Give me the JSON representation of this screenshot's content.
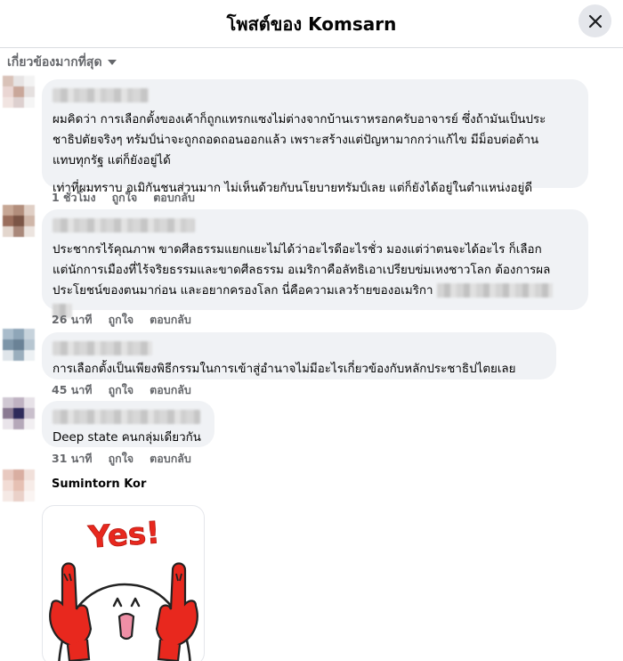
{
  "header": {
    "title": "โพสต์ของ Komsarn"
  },
  "sort": {
    "label": "เกี่ยวข้องมากที่สุด"
  },
  "comments": [
    {
      "paragraphs": [
        "ผมคิดว่า การเลือกตั้งของเค้าก็ถูกแทรกแซงไม่ต่างจากบ้านเราหรอกครับอาจารย์ ซึ่งถ้ามันเป็นประ\nชาธิปตัยจริงๆ ทรัมป์น่าจะถูกถอดถอนออกแล้ว เพราะสร้างแต่ปัญหามากกว่าแก้ไข มีม็อบต่อต้าน\nแทบทุกรัฐ แต่ก็ยังอยู่ได้",
        "เท่าที่ผมทราบ อเมิกันชนส่วนมาก ไม่เห็นด้วยกับนโยบายทรัมป์เลย แต่ก็ยังได้อยู่ในตำแหน่งอยู่ดี"
      ],
      "time": "1 ชั่วโมง",
      "like": "ถูกใจ",
      "reply": "ตอบกลับ"
    },
    {
      "paragraphs": [
        "ประชากรไร้คุณภาพ ขาดศีลธรรมแยกแยะไม่ได้ว่าอะไรดีอะไรชั่ว มองแต่ว่าตนจะได้อะไร ก็เลือก\nแต่นักการเมืองที่ไร้จริยธรรมและขาดศีลธรรม อเมริกาคือลัทธิเอาเปรียบข่มเหงชาวโลก ต้องการผล\nประโยชน์ของตนมาก่อน และอยากครองโลก นี่คือความเลวร้ายของอเมริกา"
      ],
      "time": "26 นาที",
      "like": "ถูกใจ",
      "reply": "ตอบกลับ"
    },
    {
      "paragraphs": [
        "การเลือกตั้งเป็นเพียงพิธีกรรมในการเข้าสู่อำนาจไม่มีอะไรเกี่ยวข้องกับหลักประชาธิปไตยเลย"
      ],
      "time": "45 นาที",
      "like": "ถูกใจ",
      "reply": "ตอบกลับ"
    },
    {
      "paragraphs": [
        "Deep state คนกลุ่มเดียวกัน"
      ],
      "time": "31 นาที",
      "like": "ถูกใจ",
      "reply": "ตอบกลับ"
    }
  ],
  "sticker_comment": {
    "author": "Sumintorn Kor",
    "sticker_text": "Yes!"
  },
  "colors": {
    "bubble": "#f0f2f5",
    "meta": "#65676b",
    "sticker_red": "#e8281e"
  }
}
